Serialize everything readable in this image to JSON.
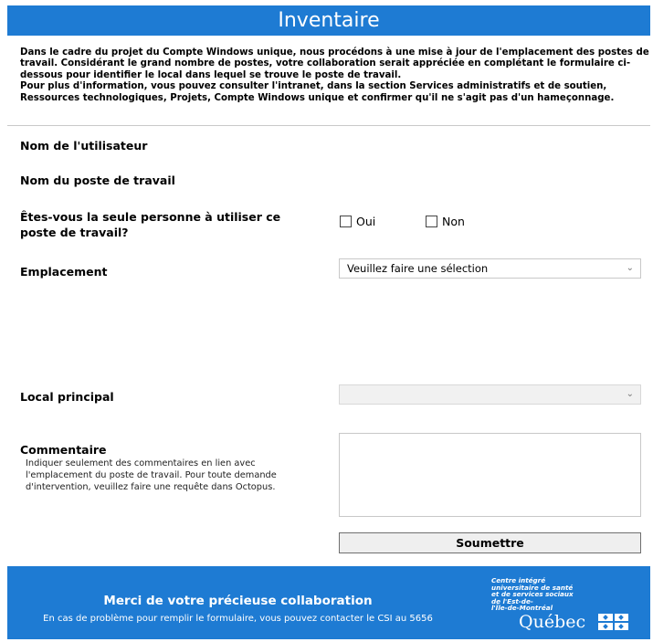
{
  "header": {
    "title": "Inventaire"
  },
  "intro": {
    "paragraph1": "Dans le cadre du projet du Compte Windows unique, nous procédons à une mise à jour de l'emplacement des postes de travail. Considérant le grand nombre de postes, votre collaboration serait appréciée en complétant le formulaire ci-dessous pour identifier le local dans lequel se trouve le poste de travail.",
    "paragraph2": "Pour plus d'information, vous pouvez consulter l'intranet, dans la section Services administratifs et de soutien, Ressources technologiques, Projets, Compte Windows unique et confirmer qu'il ne s'agit pas d'un hameçonnage."
  },
  "form": {
    "user_name_label": "Nom de l'utilisateur",
    "workstation_label": "Nom du poste de travail",
    "sole_user_label": "Êtes-vous la seule personne à utiliser ce poste de travail?",
    "yes_label": "Oui",
    "no_label": "Non",
    "location_label": "Emplacement",
    "location_selected": "Veuillez faire une sélection",
    "main_room_label": "Local principal",
    "main_room_selected": "",
    "comment_label": "Commentaire",
    "comment_help": "Indiquer seulement des commentaires en lien avec l'emplacement du poste de travail. Pour toute demande d'intervention, veuillez faire une requête dans Octopus.",
    "submit_label": "Soumettre"
  },
  "footer": {
    "thanks": "Merci de votre précieuse collaboration",
    "help": "En cas de problème pour remplir le formulaire, vous pouvez contacter le CSI au 5656",
    "org_lines": [
      "Centre intégré",
      "universitaire de santé",
      "et de services sociaux",
      "de l'Est-de-",
      "l'Île-de-Montréal"
    ],
    "logo_text": "Québec"
  },
  "colors": {
    "brand_blue": "#1e7bd3"
  }
}
